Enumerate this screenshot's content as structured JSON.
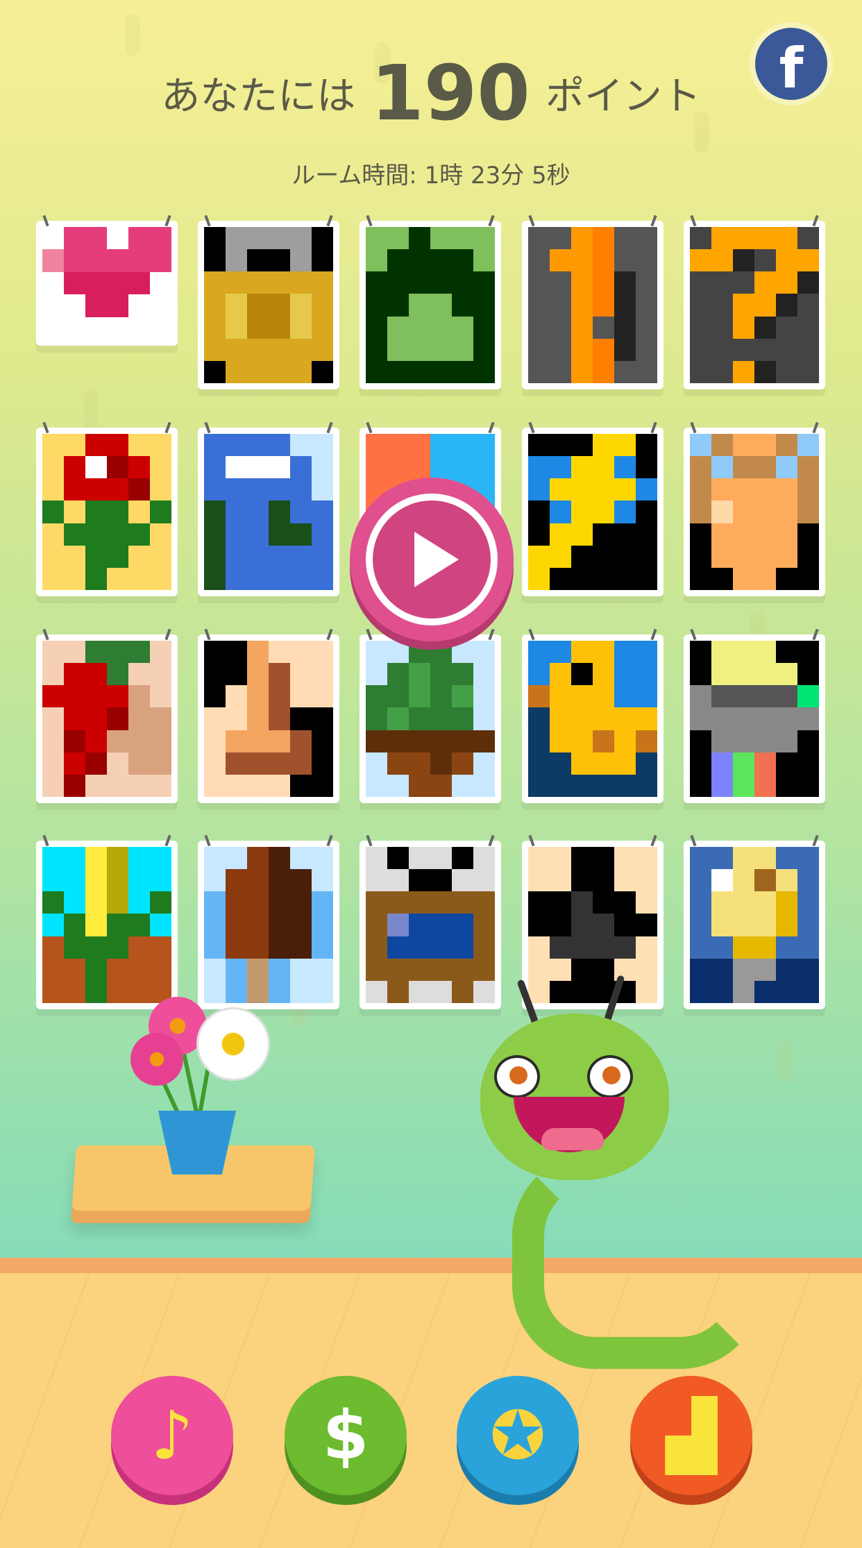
{
  "header": {
    "points_prefix": "あなたには",
    "points_value": "190",
    "points_suffix": "ポイント",
    "room_time": "ルーム時間: 1時 23分 5秒"
  },
  "facebook_icon": "f",
  "colors": {
    "play_pink": "#e0508f",
    "music_pink": "#ef4e9a",
    "shop_green": "#6dbb2f",
    "award_blue": "#2aa3da",
    "leaderboard_orange": "#f15a24"
  },
  "puzzles": [
    {
      "name": "heart",
      "cells": [
        "#ffffff",
        "#e53d7b",
        "#e53d7b",
        "#ffffff",
        "#e53d7b",
        "#e53d7b",
        "#f0849f",
        "#e53d7b",
        "#e53d7b",
        "#e53d7b",
        "#e53d7b",
        "#e53d7b",
        "#ffffff",
        "#d91e5f",
        "#d91e5f",
        "#d91e5f",
        "#d91e5f",
        "#ffffff",
        "#ffffff",
        "#ffffff",
        "#d91e5f",
        "#d91e5f",
        "#ffffff",
        "#ffffff",
        "#ffffff",
        "#ffffff",
        "#ffffff",
        "#ffffff",
        "#ffffff",
        "#ffffff"
      ]
    },
    {
      "name": "padlock",
      "cells": [
        "#000000",
        "#9e9e9e",
        "#9e9e9e",
        "#9e9e9e",
        "#9e9e9e",
        "#000000",
        "#000000",
        "#9e9e9e",
        "#000000",
        "#000000",
        "#9e9e9e",
        "#000000",
        "#d9a820",
        "#d9a820",
        "#d9a820",
        "#d9a820",
        "#d9a820",
        "#d9a820",
        "#d9a820",
        "#e6c94a",
        "#b8860b",
        "#b8860b",
        "#e6c94a",
        "#d9a820",
        "#d9a820",
        "#e6c94a",
        "#b8860b",
        "#b8860b",
        "#e6c94a",
        "#d9a820",
        "#d9a820",
        "#d9a820",
        "#d9a820",
        "#d9a820",
        "#d9a820",
        "#d9a820",
        "#000000",
        "#d9a820",
        "#d9a820",
        "#d9a820",
        "#d9a820",
        "#000000"
      ]
    },
    {
      "name": "melon",
      "cells": [
        "#7fbf5c",
        "#7fbf5c",
        "#003300",
        "#7fbf5c",
        "#7fbf5c",
        "#7fbf5c",
        "#7fbf5c",
        "#003300",
        "#003300",
        "#003300",
        "#003300",
        "#7fbf5c",
        "#003300",
        "#003300",
        "#003300",
        "#003300",
        "#003300",
        "#003300",
        "#003300",
        "#003300",
        "#7fbf5c",
        "#7fbf5c",
        "#003300",
        "#003300",
        "#003300",
        "#7fbf5c",
        "#7fbf5c",
        "#7fbf5c",
        "#7fbf5c",
        "#003300",
        "#003300",
        "#7fbf5c",
        "#7fbf5c",
        "#7fbf5c",
        "#7fbf5c",
        "#003300",
        "#003300",
        "#003300",
        "#003300",
        "#003300",
        "#003300",
        "#003300"
      ]
    },
    {
      "name": "exclamation",
      "cells": [
        "#555555",
        "#555555",
        "#ff9900",
        "#ff8000",
        "#555555",
        "#555555",
        "#555555",
        "#ff9900",
        "#ff9900",
        "#ff8000",
        "#555555",
        "#555555",
        "#555555",
        "#555555",
        "#ff9900",
        "#ff8000",
        "#222222",
        "#555555",
        "#555555",
        "#555555",
        "#ff9900",
        "#ff8000",
        "#222222",
        "#555555",
        "#555555",
        "#555555",
        "#ff9900",
        "#555555",
        "#222222",
        "#555555",
        "#555555",
        "#555555",
        "#ff9900",
        "#ff8000",
        "#222222",
        "#555555",
        "#555555",
        "#555555",
        "#ff9900",
        "#ff8000",
        "#555555",
        "#555555"
      ]
    },
    {
      "name": "question",
      "cells": [
        "#444444",
        "#ffa500",
        "#ffa500",
        "#ffa500",
        "#ffa500",
        "#444444",
        "#ffa500",
        "#ffa500",
        "#222222",
        "#444444",
        "#ffa500",
        "#ffa500",
        "#444444",
        "#444444",
        "#444444",
        "#ffa500",
        "#ffa500",
        "#222222",
        "#444444",
        "#444444",
        "#ffa500",
        "#ffa500",
        "#222222",
        "#444444",
        "#444444",
        "#444444",
        "#ffa500",
        "#222222",
        "#444444",
        "#444444",
        "#444444",
        "#444444",
        "#444444",
        "#444444",
        "#444444",
        "#444444",
        "#444444",
        "#444444",
        "#ffa500",
        "#222222",
        "#444444",
        "#444444"
      ]
    },
    {
      "name": "rose",
      "cells": [
        "#ffd966",
        "#ffd966",
        "#cc0000",
        "#cc0000",
        "#ffd966",
        "#ffd966",
        "#ffd966",
        "#cc0000",
        "#ffffff",
        "#990000",
        "#cc0000",
        "#ffd966",
        "#ffd966",
        "#cc0000",
        "#cc0000",
        "#cc0000",
        "#990000",
        "#ffd966",
        "#1e7b1e",
        "#ffd966",
        "#1e7b1e",
        "#1e7b1e",
        "#ffd966",
        "#1e7b1e",
        "#ffd966",
        "#1e7b1e",
        "#1e7b1e",
        "#1e7b1e",
        "#1e7b1e",
        "#ffd966",
        "#ffd966",
        "#ffd966",
        "#1e7b1e",
        "#1e7b1e",
        "#ffd966",
        "#ffd966",
        "#ffd966",
        "#ffd966",
        "#1e7b1e",
        "#ffd966",
        "#ffd966",
        "#ffd966"
      ]
    },
    {
      "name": "blue-figure",
      "cells": [
        "#3a6fd8",
        "#3a6fd8",
        "#3a6fd8",
        "#3a6fd8",
        "#c8e8ff",
        "#c8e8ff",
        "#3a6fd8",
        "#ffffff",
        "#ffffff",
        "#ffffff",
        "#3a6fd8",
        "#c8e8ff",
        "#3a6fd8",
        "#3a6fd8",
        "#3a6fd8",
        "#3a6fd8",
        "#3a6fd8",
        "#c8e8ff",
        "#1a4f1a",
        "#3a6fd8",
        "#3a6fd8",
        "#1a4f1a",
        "#3a6fd8",
        "#3a6fd8",
        "#1a4f1a",
        "#3a6fd8",
        "#3a6fd8",
        "#1a4f1a",
        "#1a4f1a",
        "#3a6fd8",
        "#1a4f1a",
        "#3a6fd8",
        "#3a6fd8",
        "#3a6fd8",
        "#3a6fd8",
        "#3a6fd8",
        "#1a4f1a",
        "#3a6fd8",
        "#3a6fd8",
        "#3a6fd8",
        "#3a6fd8",
        "#3a6fd8"
      ]
    },
    {
      "name": "fox",
      "cells": [
        "#ff7043",
        "#ff7043",
        "#ff7043",
        "#29b6f6",
        "#29b6f6",
        "#29b6f6",
        "#ff7043",
        "#ff7043",
        "#ff7043",
        "#29b6f6",
        "#29b6f6",
        "#29b6f6",
        "#ff7043",
        "#ff7043",
        "#ff7043",
        "#29b6f6",
        "#29b6f6",
        "#29b6f6",
        "#ff7043",
        "#ff7043",
        "#ff7043",
        "#29b6f6",
        "#29b6f6",
        "#29b6f6",
        "#ff7043",
        "#ff7043",
        "#ff7043",
        "#29b6f6",
        "#29b6f6",
        "#29b6f6",
        "#ff7043",
        "#ff7043",
        "#ff7043",
        "#29b6f6",
        "#29b6f6",
        "#29b6f6",
        "#ff7043",
        "#ff7043",
        "#ff7043",
        "#29b6f6",
        "#29b6f6",
        "#29b6f6"
      ]
    },
    {
      "name": "lightning",
      "cells": [
        "#000000",
        "#000000",
        "#000000",
        "#ffd700",
        "#ffd700",
        "#000000",
        "#1e88e5",
        "#1e88e5",
        "#ffd700",
        "#ffd700",
        "#1e88e5",
        "#000000",
        "#1e88e5",
        "#ffd700",
        "#ffd700",
        "#ffd700",
        "#ffd700",
        "#1e88e5",
        "#000000",
        "#1e88e5",
        "#ffd700",
        "#ffd700",
        "#1e88e5",
        "#000000",
        "#000000",
        "#ffd700",
        "#ffd700",
        "#000000",
        "#000000",
        "#000000",
        "#ffd700",
        "#ffd700",
        "#000000",
        "#000000",
        "#000000",
        "#000000",
        "#ffd700",
        "#000000",
        "#000000",
        "#000000",
        "#000000",
        "#000000"
      ]
    },
    {
      "name": "vase",
      "cells": [
        "#90caf9",
        "#c28a4a",
        "#ffab5c",
        "#ffab5c",
        "#c28a4a",
        "#90caf9",
        "#c28a4a",
        "#90caf9",
        "#c28a4a",
        "#c28a4a",
        "#90caf9",
        "#c28a4a",
        "#c28a4a",
        "#ffab5c",
        "#ffab5c",
        "#ffab5c",
        "#ffab5c",
        "#c28a4a",
        "#c28a4a",
        "#ffd8a8",
        "#ffab5c",
        "#ffab5c",
        "#ffab5c",
        "#c28a4a",
        "#000000",
        "#ffab5c",
        "#ffab5c",
        "#ffab5c",
        "#ffab5c",
        "#000000",
        "#000000",
        "#ffab5c",
        "#ffab5c",
        "#ffab5c",
        "#ffab5c",
        "#000000",
        "#000000",
        "#000000",
        "#ffab5c",
        "#ffab5c",
        "#000000",
        "#000000"
      ]
    },
    {
      "name": "pepper",
      "cells": [
        "#f5d0b5",
        "#f5d0b5",
        "#2e7d32",
        "#2e7d32",
        "#2e7d32",
        "#f5d0b5",
        "#f5d0b5",
        "#cc0000",
        "#cc0000",
        "#2e7d32",
        "#f5d0b5",
        "#f5d0b5",
        "#cc0000",
        "#cc0000",
        "#cc0000",
        "#cc0000",
        "#d9a27f",
        "#f5d0b5",
        "#f5d0b5",
        "#cc0000",
        "#cc0000",
        "#990000",
        "#d9a27f",
        "#d9a27f",
        "#f5d0b5",
        "#990000",
        "#cc0000",
        "#d9a27f",
        "#d9a27f",
        "#d9a27f",
        "#f5d0b5",
        "#cc0000",
        "#990000",
        "#f5d0b5",
        "#d9a27f",
        "#d9a27f",
        "#f5d0b5",
        "#990000",
        "#f5d0b5",
        "#f5d0b5",
        "#f5d0b5",
        "#f5d0b5"
      ]
    },
    {
      "name": "chess-piece",
      "cells": [
        "#000000",
        "#000000",
        "#f4a660",
        "#ffdcb5",
        "#ffdcb5",
        "#ffdcb5",
        "#000000",
        "#000000",
        "#f4a660",
        "#a0522d",
        "#ffdcb5",
        "#ffdcb5",
        "#000000",
        "#ffdcb5",
        "#f4a660",
        "#a0522d",
        "#ffdcb5",
        "#ffdcb5",
        "#ffdcb5",
        "#ffdcb5",
        "#f4a660",
        "#a0522d",
        "#000000",
        "#000000",
        "#ffdcb5",
        "#f4a660",
        "#f4a660",
        "#f4a660",
        "#a0522d",
        "#000000",
        "#ffdcb5",
        "#a0522d",
        "#a0522d",
        "#a0522d",
        "#a0522d",
        "#000000",
        "#ffdcb5",
        "#ffdcb5",
        "#ffdcb5",
        "#ffdcb5",
        "#000000",
        "#000000"
      ]
    },
    {
      "name": "plant",
      "cells": [
        "#c8e8ff",
        "#c8e8ff",
        "#2e7d32",
        "#2e7d32",
        "#c8e8ff",
        "#c8e8ff",
        "#c8e8ff",
        "#2e7d32",
        "#43a047",
        "#2e7d32",
        "#2e7d32",
        "#c8e8ff",
        "#2e7d32",
        "#2e7d32",
        "#43a047",
        "#2e7d32",
        "#43a047",
        "#c8e8ff",
        "#2e7d32",
        "#43a047",
        "#2e7d32",
        "#2e7d32",
        "#2e7d32",
        "#c8e8ff",
        "#5d2e0a",
        "#5d2e0a",
        "#5d2e0a",
        "#5d2e0a",
        "#5d2e0a",
        "#5d2e0a",
        "#c8e8ff",
        "#8b4513",
        "#8b4513",
        "#5d2e0a",
        "#8b4513",
        "#c8e8ff",
        "#c8e8ff",
        "#c8e8ff",
        "#8b4513",
        "#8b4513",
        "#c8e8ff",
        "#c8e8ff"
      ]
    },
    {
      "name": "duck",
      "cells": [
        "#1e88e5",
        "#1e88e5",
        "#ffc107",
        "#ffc107",
        "#1e88e5",
        "#1e88e5",
        "#1e88e5",
        "#ffc107",
        "#000000",
        "#ffc107",
        "#1e88e5",
        "#1e88e5",
        "#c8741a",
        "#ffc107",
        "#ffc107",
        "#ffc107",
        "#1e88e5",
        "#1e88e5",
        "#0d3a66",
        "#ffc107",
        "#ffc107",
        "#ffc107",
        "#ffc107",
        "#ffc107",
        "#0d3a66",
        "#ffc107",
        "#ffc107",
        "#c8741a",
        "#ffc107",
        "#c8741a",
        "#0d3a66",
        "#0d3a66",
        "#ffc107",
        "#ffc107",
        "#ffc107",
        "#0d3a66",
        "#0d3a66",
        "#0d3a66",
        "#0d3a66",
        "#0d3a66",
        "#0d3a66",
        "#0d3a66"
      ]
    },
    {
      "name": "lamp",
      "cells": [
        "#000000",
        "#f0f080",
        "#f0f080",
        "#f0f080",
        "#000000",
        "#000000",
        "#000000",
        "#f0f080",
        "#f0f080",
        "#f0f080",
        "#f0f080",
        "#000000",
        "#888888",
        "#555555",
        "#555555",
        "#555555",
        "#555555",
        "#00e676",
        "#888888",
        "#888888",
        "#888888",
        "#888888",
        "#888888",
        "#888888",
        "#000000",
        "#888888",
        "#888888",
        "#888888",
        "#888888",
        "#000000",
        "#000000",
        "#7c83fd",
        "#5ce65c",
        "#f07050",
        "#000000",
        "#000000",
        "#000000",
        "#7c83fd",
        "#5ce65c",
        "#f07050",
        "#000000",
        "#000000"
      ]
    },
    {
      "name": "corn",
      "cells": [
        "#00e5ff",
        "#00e5ff",
        "#ffeb3b",
        "#b5a90a",
        "#00e5ff",
        "#00e5ff",
        "#00e5ff",
        "#00e5ff",
        "#ffeb3b",
        "#b5a90a",
        "#00e5ff",
        "#00e5ff",
        "#1e7b1e",
        "#00e5ff",
        "#ffeb3b",
        "#b5a90a",
        "#00e5ff",
        "#1e7b1e",
        "#00e5ff",
        "#1e7b1e",
        "#ffeb3b",
        "#1e7b1e",
        "#1e7b1e",
        "#00e5ff",
        "#b5541c",
        "#1e7b1e",
        "#1e7b1e",
        "#1e7b1e",
        "#b5541c",
        "#b5541c",
        "#b5541c",
        "#b5541c",
        "#1e7b1e",
        "#b5541c",
        "#b5541c",
        "#b5541c",
        "#b5541c",
        "#b5541c",
        "#1e7b1e",
        "#b5541c",
        "#b5541c",
        "#b5541c"
      ]
    },
    {
      "name": "popsicle",
      "cells": [
        "#c8e8ff",
        "#c8e8ff",
        "#8b3a0f",
        "#4a1f0a",
        "#c8e8ff",
        "#c8e8ff",
        "#c8e8ff",
        "#8b3a0f",
        "#8b3a0f",
        "#4a1f0a",
        "#4a1f0a",
        "#c8e8ff",
        "#64b5f6",
        "#8b3a0f",
        "#8b3a0f",
        "#4a1f0a",
        "#4a1f0a",
        "#64b5f6",
        "#64b5f6",
        "#8b3a0f",
        "#8b3a0f",
        "#4a1f0a",
        "#4a1f0a",
        "#64b5f6",
        "#64b5f6",
        "#8b3a0f",
        "#8b3a0f",
        "#4a1f0a",
        "#4a1f0a",
        "#64b5f6",
        "#c8e8ff",
        "#64b5f6",
        "#c19a6b",
        "#64b5f6",
        "#c8e8ff",
        "#c8e8ff",
        "#c8e8ff",
        "#64b5f6",
        "#c19a6b",
        "#64b5f6",
        "#c8e8ff",
        "#c8e8ff"
      ]
    },
    {
      "name": "tv",
      "cells": [
        "#dddddd",
        "#000000",
        "#dddddd",
        "#dddddd",
        "#000000",
        "#dddddd",
        "#dddddd",
        "#dddddd",
        "#000000",
        "#000000",
        "#dddddd",
        "#dddddd",
        "#8b5a1a",
        "#8b5a1a",
        "#8b5a1a",
        "#8b5a1a",
        "#8b5a1a",
        "#8b5a1a",
        "#8b5a1a",
        "#7986cb",
        "#0d47a1",
        "#0d47a1",
        "#0d47a1",
        "#8b5a1a",
        "#8b5a1a",
        "#0d47a1",
        "#0d47a1",
        "#0d47a1",
        "#0d47a1",
        "#8b5a1a",
        "#8b5a1a",
        "#8b5a1a",
        "#8b5a1a",
        "#8b5a1a",
        "#8b5a1a",
        "#8b5a1a",
        "#dddddd",
        "#8b5a1a",
        "#dddddd",
        "#dddddd",
        "#8b5a1a",
        "#dddddd"
      ]
    },
    {
      "name": "club",
      "cells": [
        "#ffe0b5",
        "#ffe0b5",
        "#000000",
        "#000000",
        "#ffe0b5",
        "#ffe0b5",
        "#ffe0b5",
        "#ffe0b5",
        "#000000",
        "#000000",
        "#ffe0b5",
        "#ffe0b5",
        "#000000",
        "#000000",
        "#333333",
        "#000000",
        "#000000",
        "#ffe0b5",
        "#000000",
        "#000000",
        "#333333",
        "#333333",
        "#000000",
        "#000000",
        "#ffe0b5",
        "#333333",
        "#333333",
        "#333333",
        "#333333",
        "#ffe0b5",
        "#ffe0b5",
        "#ffe0b5",
        "#000000",
        "#000000",
        "#ffe0b5",
        "#ffe0b5",
        "#ffe0b5",
        "#000000",
        "#000000",
        "#000000",
        "#000000",
        "#ffe0b5"
      ]
    },
    {
      "name": "lightbulb",
      "cells": [
        "#3b6bb5",
        "#3b6bb5",
        "#f5e07a",
        "#f5e07a",
        "#3b6bb5",
        "#3b6bb5",
        "#3b6bb5",
        "#ffffff",
        "#f5e07a",
        "#a0651e",
        "#f5e07a",
        "#3b6bb5",
        "#3b6bb5",
        "#f5e07a",
        "#f5e07a",
        "#f5e07a",
        "#e6b800",
        "#3b6bb5",
        "#3b6bb5",
        "#f5e07a",
        "#f5e07a",
        "#f5e07a",
        "#e6b800",
        "#3b6bb5",
        "#3b6bb5",
        "#3b6bb5",
        "#e6b800",
        "#e6b800",
        "#3b6bb5",
        "#3b6bb5",
        "#0a2e6b",
        "#0a2e6b",
        "#999999",
        "#999999",
        "#0a2e6b",
        "#0a2e6b",
        "#0a2e6b",
        "#0a2e6b",
        "#999999",
        "#0a2e6b",
        "#0a2e6b",
        "#0a2e6b"
      ]
    }
  ],
  "bottom_buttons": [
    {
      "name": "music-button",
      "icon": "music-note-icon",
      "glyph": "♪",
      "color": "#ef4e9a"
    },
    {
      "name": "shop-button",
      "icon": "dollar-icon",
      "glyph": "$",
      "color": "#6dbb2f"
    },
    {
      "name": "achievements-button",
      "icon": "medal-icon",
      "glyph": "✪",
      "color": "#2aa3da"
    },
    {
      "name": "leaderboard-button",
      "icon": "podium-icon",
      "glyph": "▟",
      "color": "#f15a24"
    }
  ]
}
